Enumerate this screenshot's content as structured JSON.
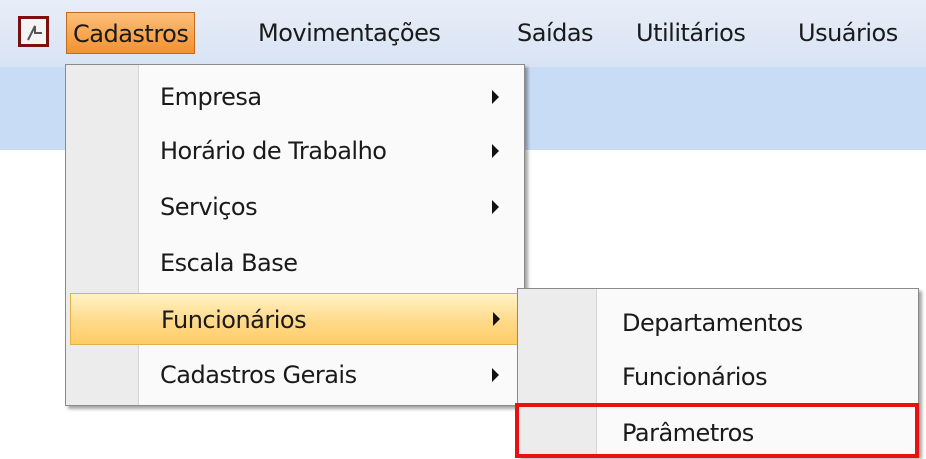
{
  "menubar": {
    "items": [
      {
        "label": "Cadastros"
      },
      {
        "label": "Movimentações"
      },
      {
        "label": "Saídas"
      },
      {
        "label": "Utilitários"
      },
      {
        "label": "Usuários"
      }
    ]
  },
  "cadastros_menu": {
    "items": [
      {
        "label": "Empresa"
      },
      {
        "label": "Horário de Trabalho"
      },
      {
        "label": "Serviços"
      },
      {
        "label": "Escala Base"
      },
      {
        "label": "Funcionários"
      },
      {
        "label": "Cadastros Gerais"
      }
    ]
  },
  "funcionarios_submenu": {
    "items": [
      {
        "label": "Departamentos"
      },
      {
        "label": "Funcionários"
      },
      {
        "label": "Parâmetros"
      }
    ]
  },
  "colors": {
    "menubar_bg": "#dfe8f6",
    "active_menu": "#f4912f",
    "highlight": "#ffd98a",
    "annotation": "#e81010"
  }
}
